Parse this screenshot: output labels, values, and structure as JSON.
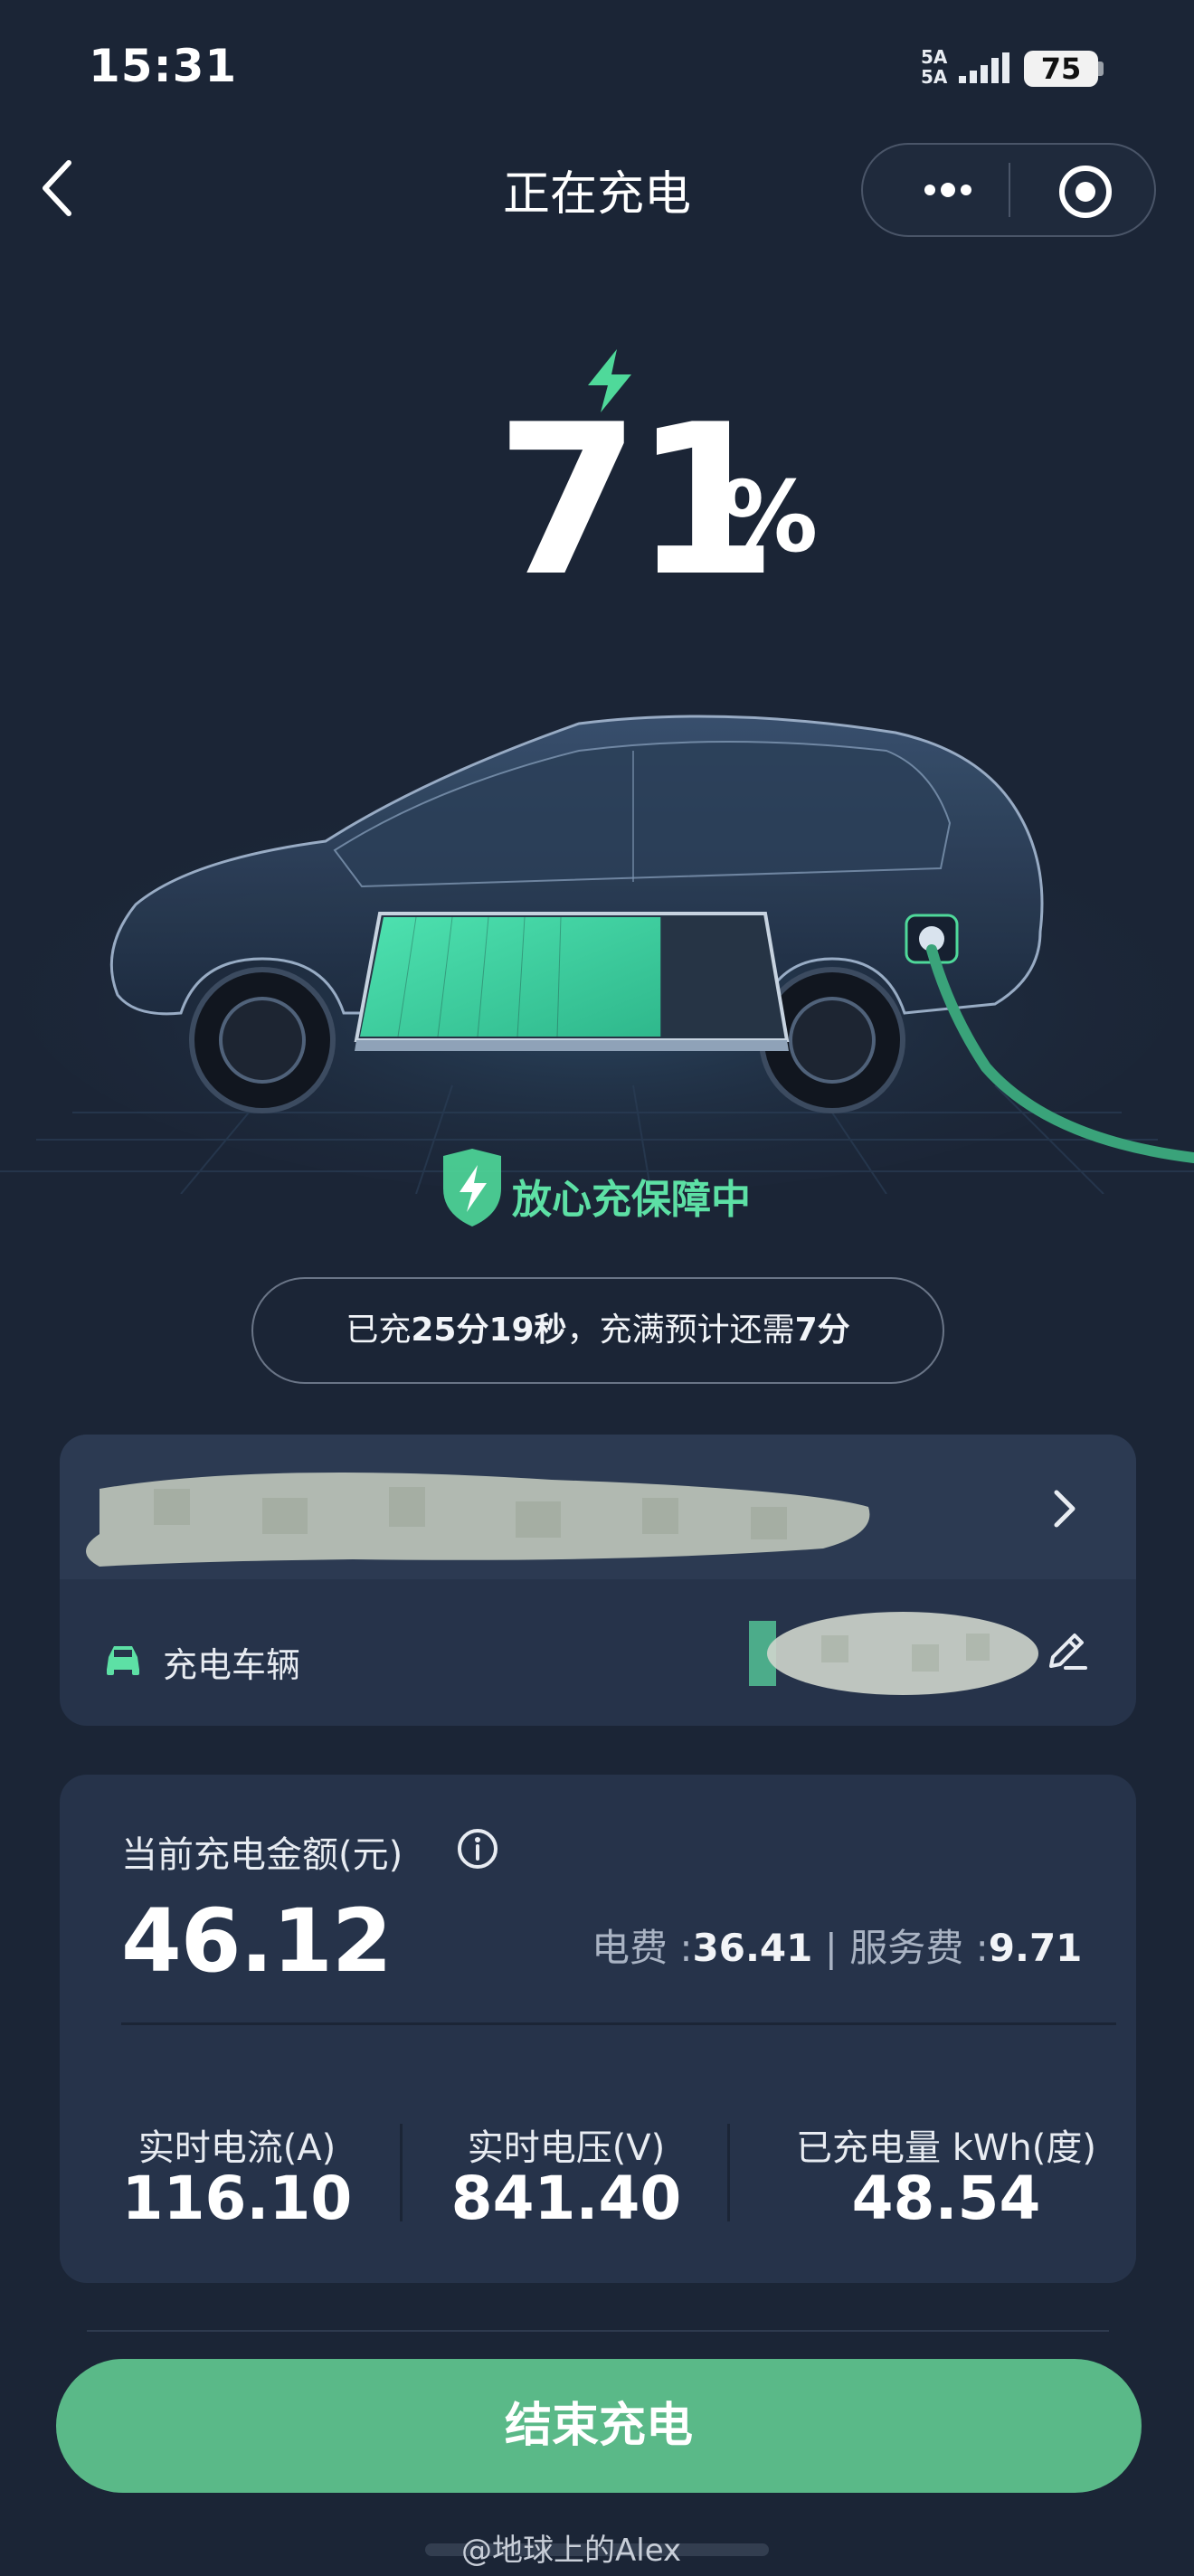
{
  "status_bar": {
    "time": "15:31",
    "signal": "5A",
    "battery": "75"
  },
  "nav": {
    "title": "正在充电"
  },
  "charge": {
    "percent": "71",
    "percent_sign": "%",
    "level": 0.71
  },
  "assurance": {
    "text": "放心充保障中"
  },
  "charge_time": {
    "prefix": "已充",
    "elapsed": "25分19秒",
    "middle": "，充满预计还需",
    "remaining": "7分"
  },
  "vehicle": {
    "label": "充电车辆"
  },
  "amount": {
    "label": "当前充电金额(元)",
    "value": "46.12",
    "electric_label": "电费 :",
    "electric_value": "36.41",
    "separator": "|",
    "service_label": "服务费 :",
    "service_value": "9.71"
  },
  "stats": [
    {
      "label": "实时电流(A)",
      "value": "116.10"
    },
    {
      "label": "实时电压(V)",
      "value": "841.40"
    },
    {
      "label": "已充电量 kWh(度)",
      "value": "48.54"
    }
  ],
  "end_button": {
    "label": "结束充电"
  },
  "watermark": {
    "text": "@地球上的Alex"
  },
  "colors": {
    "background": "#1b2536",
    "card": "#26334a",
    "accent": "#5ab988",
    "charge_green": "#5de0a5"
  },
  "icons": [
    "back-icon",
    "more-icon",
    "target-icon",
    "bolt-icon",
    "shield-bolt-icon",
    "chevron-right-icon",
    "car-icon",
    "edit-pencil-icon",
    "info-icon"
  ]
}
